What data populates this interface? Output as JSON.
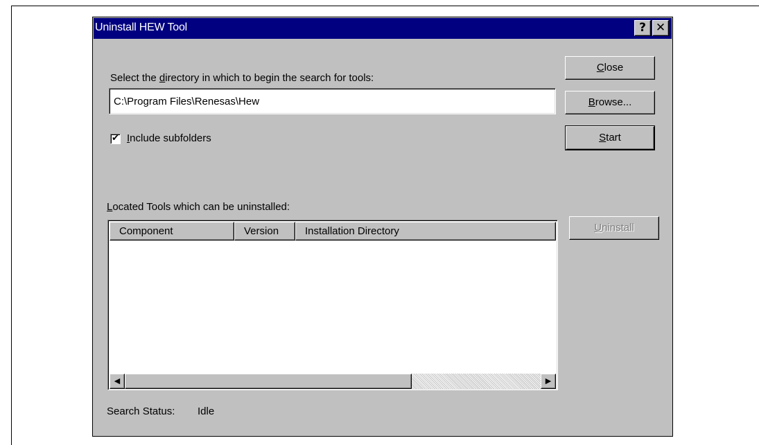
{
  "window": {
    "title": "Uninstall HEW Tool",
    "help_glyph": "?",
    "close_glyph": "✕"
  },
  "search": {
    "label_pre": "Select the ",
    "label_accel": "d",
    "label_post": "irectory in which to begin the search for tools:",
    "directory_value": "C:\\Program Files\\Renesas\\Hew",
    "include_subfolders": {
      "checked": true,
      "check_glyph": "✔",
      "label_accel": "I",
      "label_post": "nclude subfolders"
    }
  },
  "buttons": {
    "close": {
      "accel": "C",
      "rest": "lose"
    },
    "browse": {
      "accel": "B",
      "rest": "rowse..."
    },
    "start": {
      "accel": "S",
      "rest": "tart"
    },
    "uninstall": {
      "accel": "U",
      "rest": "ninstall",
      "enabled": false
    }
  },
  "located": {
    "label_accel": "L",
    "label_post": "ocated Tools which can be uninstalled:",
    "columns": [
      "Component",
      "Version",
      "Installation Directory"
    ],
    "rows": []
  },
  "scrollbar": {
    "left_glyph": "◀",
    "right_glyph": "▶"
  },
  "status": {
    "label": "Search Status:",
    "value": "Idle"
  },
  "colors": {
    "titlebar": "#000080",
    "dialog_face": "#c0c0c0",
    "disabled_text": "#808080"
  }
}
